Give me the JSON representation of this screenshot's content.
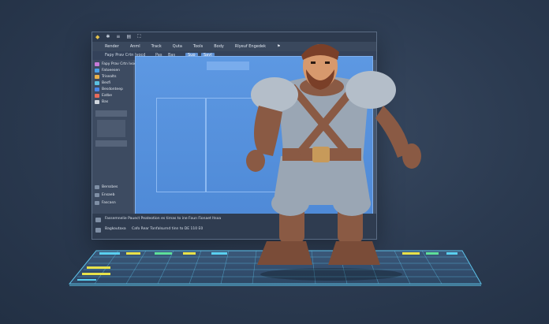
{
  "window": {
    "titlebar_items": [
      "◆",
      "✱",
      "≡",
      "▤",
      "⛶"
    ],
    "menu": [
      "Render",
      "Anml",
      "Track",
      "Quta",
      "Tools",
      "Body",
      "Rlyeuf Engedek",
      "⚑"
    ],
    "toolbar": {
      "left": [
        "Fapy Prav Crtn Ivocd",
        "Pas",
        "Bas"
      ],
      "pill_a": "Sup",
      "pill_b": "Sayl"
    }
  },
  "sidebar": {
    "items": [
      {
        "label": "Fapy Prav Crtn Ivocd",
        "color": "#c77ad8"
      },
      {
        "label": "Fatoeesen",
        "color": "#4aa0e8"
      },
      {
        "label": "Trisealts",
        "color": "#e8b04a"
      },
      {
        "label": "Besfi",
        "color": "#5cc0e0"
      },
      {
        "label": "Besdonteep",
        "color": "#4a86e8"
      },
      {
        "label": "Eatbe",
        "color": "#e86a5a"
      },
      {
        "label": "Bas",
        "color": "#d0d6de"
      }
    ],
    "lower_items": [
      "Berssbes",
      "Ensaeb",
      "Fascasn"
    ]
  },
  "status": {
    "line1": "Fassemnelie Pauect Peateotion es tirnas to ine Foun Fionaet Itsoa",
    "line2_label": "Bagkoutaxa",
    "line2_text": "Cafo Rear Tonfalsurnd tinn to DE 110 E0"
  },
  "colors": {
    "background": "#2b3a50",
    "viewport": "#5d98e2",
    "timeline_glow": "#5fc8f0",
    "clip_yellow": "#e8e24a",
    "clip_green": "#5ee09a",
    "clip_cyan": "#5ad0f0",
    "armor": "#9aa6b4",
    "leather": "#8a5a44",
    "skin": "#d7996d",
    "hair": "#7a3f28"
  },
  "icons": [
    "app-logo-icon",
    "timeline-track",
    "character-model"
  ]
}
